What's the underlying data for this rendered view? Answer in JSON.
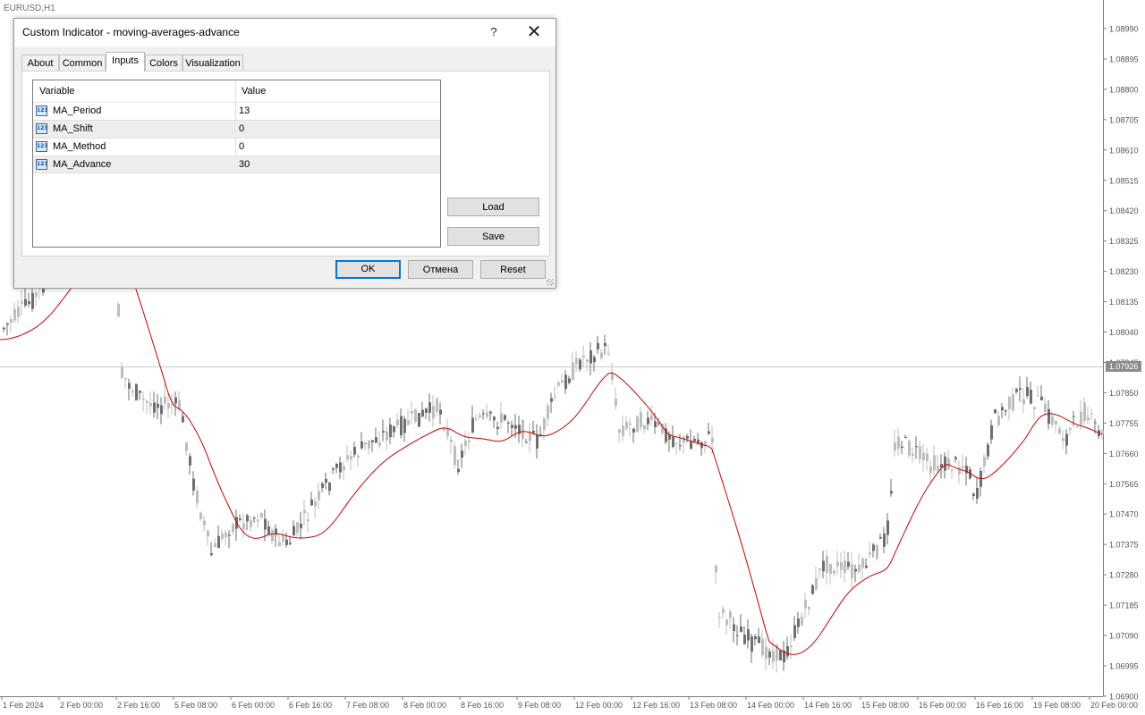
{
  "chart": {
    "symbol_label": "EURUSD,H1",
    "current_price": "1.07926",
    "price_labels": [
      "1.08990",
      "1.08895",
      "1.08800",
      "1.08705",
      "1.08610",
      "1.08515",
      "1.08420",
      "1.08325",
      "1.08230",
      "1.08135",
      "1.08040",
      "1.07945",
      "1.07850",
      "1.07755",
      "1.07660",
      "1.07565",
      "1.07470",
      "1.07375",
      "1.07280",
      "1.07185",
      "1.07090",
      "1.06995",
      "1.06900"
    ],
    "time_labels": [
      "1 Feb 2024",
      "2 Feb 00:00",
      "2 Feb 16:00",
      "5 Feb 08:00",
      "6 Feb 00:00",
      "6 Feb 16:00",
      "7 Feb 08:00",
      "8 Feb 00:00",
      "8 Feb 16:00",
      "9 Feb 08:00",
      "12 Feb 00:00",
      "12 Feb 16:00",
      "13 Feb 08:00",
      "14 Feb 00:00",
      "14 Feb 16:00",
      "15 Feb 08:00",
      "16 Feb 00:00",
      "16 Feb 16:00",
      "19 Feb 08:00",
      "20 Feb 00:00"
    ],
    "ma_color": "#cc0000",
    "bull_color": "#bdbdbd",
    "bear_color": "#6e6e6e"
  },
  "dialog": {
    "title": "Custom Indicator - moving-averages-advance",
    "help_label": "?",
    "close_label": "✕",
    "tabs": [
      {
        "label": "About"
      },
      {
        "label": "Common"
      },
      {
        "label": "Inputs",
        "active": true
      },
      {
        "label": "Colors"
      },
      {
        "label": "Visualization"
      }
    ],
    "table": {
      "headers": {
        "variable": "Variable",
        "value": "Value"
      },
      "type_icon": "integer-type-icon",
      "type_icon_text": "123",
      "rows": [
        {
          "name": "MA_Period",
          "value": "13"
        },
        {
          "name": "MA_Shift",
          "value": "0"
        },
        {
          "name": "MA_Method",
          "value": "0"
        },
        {
          "name": "MA_Advance",
          "value": "30"
        }
      ]
    },
    "load_label": "Load",
    "save_label": "Save",
    "ok_label": "OK",
    "cancel_label": "Отмена",
    "reset_label": "Reset"
  }
}
